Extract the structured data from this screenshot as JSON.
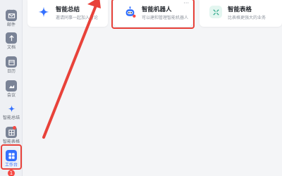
{
  "sidebar": {
    "items": [
      {
        "label": "消息",
        "icon": "message-icon"
      },
      {
        "label": "邮件",
        "icon": "mail-icon"
      },
      {
        "label": "文档",
        "icon": "docs-icon"
      },
      {
        "label": "日历",
        "icon": "calendar-icon"
      },
      {
        "label": "会议",
        "icon": "meeting-icon"
      },
      {
        "label": "智能总结",
        "icon": "sparkle-icon"
      },
      {
        "label": "智能表格",
        "icon": "smart-sheet-icon"
      },
      {
        "label": "工作台",
        "icon": "workbench-icon"
      }
    ],
    "bottom_badge": "1"
  },
  "cards": [
    {
      "title": "智能总结",
      "desc": "邀请同事一起加入讨论",
      "icon": "sparkle-icon"
    },
    {
      "title": "智能机器人",
      "desc": "可以建和管理智能机器人",
      "icon": "robot-icon",
      "more": "···"
    },
    {
      "title": "智能表格",
      "desc": "比表格更强大的业务",
      "icon": "smart-sheet-icon"
    }
  ],
  "colors": {
    "accent": "#3370ff",
    "highlight": "#e8423a",
    "sidebar_bg": "#eef0f4"
  }
}
